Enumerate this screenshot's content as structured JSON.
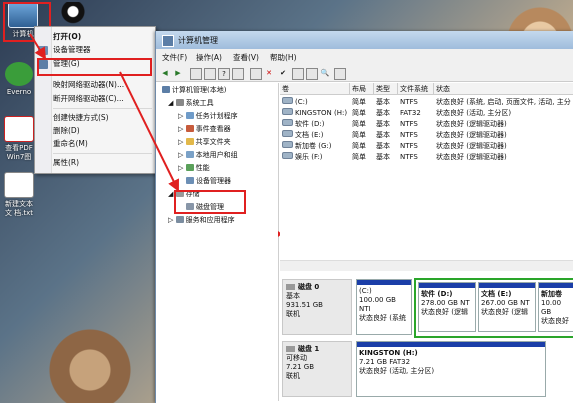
{
  "desktop": {
    "computer_icon_label": "计算机",
    "icons": [
      {
        "label": "Everno",
        "top": 0
      },
      {
        "label": "查看PDF Win7图",
        "top": 0
      },
      {
        "label": "新建文本文 档.txt",
        "top": 0
      }
    ]
  },
  "context_menu": {
    "items": [
      {
        "label": "打开(O)",
        "bold": true
      },
      {
        "label": "设备管理器",
        "bold": false
      },
      {
        "label": "管理(G)",
        "bold": false
      },
      {
        "label": "映射网络驱动器(N)...",
        "bold": false
      },
      {
        "label": "断开网络驱动器(C)...",
        "bold": false
      },
      {
        "label": "创建快捷方式(S)",
        "bold": false
      },
      {
        "label": "删除(D)",
        "bold": false
      },
      {
        "label": "重命名(M)",
        "bold": false
      },
      {
        "label": "属性(R)",
        "bold": false
      }
    ]
  },
  "window": {
    "title": "计算机管理",
    "menu": [
      "文件(F)",
      "操作(A)",
      "查看(V)",
      "帮助(H)"
    ]
  },
  "tree": {
    "root": "计算机管理(本地)",
    "system_tools": "系统工具",
    "task_scheduler": "任务计划程序",
    "event_viewer": "事件查看器",
    "shared_folders": "共享文件夹",
    "local_users": "本地用户和组",
    "performance": "性能",
    "device_manager": "设备管理器",
    "storage": "存储",
    "disk_management": "磁盘管理",
    "services": "服务和应用程序"
  },
  "volumes": {
    "headers": [
      "卷",
      "布局",
      "类型",
      "文件系统",
      "状态"
    ],
    "rows": [
      [
        "(C:)",
        "简单",
        "基本",
        "NTFS",
        "状态良好 (系统, 启动, 页面文件, 活动, 主分"
      ],
      [
        "KINGSTON (H:)",
        "简单",
        "基本",
        "FAT32",
        "状态良好 (活动, 主分区)"
      ],
      [
        "软件 (D:)",
        "简单",
        "基本",
        "NTFS",
        "状态良好 (逻辑驱动器)"
      ],
      [
        "文档 (E:)",
        "简单",
        "基本",
        "NTFS",
        "状态良好 (逻辑驱动器)"
      ],
      [
        "新加卷 (G:)",
        "简单",
        "基本",
        "NTFS",
        "状态良好 (逻辑驱动器)"
      ],
      [
        "娱乐 (F:)",
        "简单",
        "基本",
        "NTFS",
        "状态良好 (逻辑驱动器)"
      ]
    ]
  },
  "disk0": {
    "name": "磁盘 0",
    "type": "基本",
    "size": "931.51 GB",
    "status": "联机",
    "partitions": [
      {
        "name": "(C:)",
        "size": "100.00 GB NTI",
        "status": "状态良好 (系统"
      },
      {
        "name": "软件 (D:)",
        "size": "278.00 GB NT",
        "status": "状态良好 (逻辑"
      },
      {
        "name": "文档 (E:)",
        "size": "267.00 GB NT",
        "status": "状态良好 (逻辑"
      },
      {
        "name": "新加卷",
        "size": "10.00 GB",
        "status": "状态良好"
      }
    ]
  },
  "disk1": {
    "name": "磁盘 1",
    "type": "可移动",
    "size": "7.21 GB",
    "status": "联机",
    "partition": {
      "name": "KINGSTON  (H:)",
      "size": "7.21 GB FAT32",
      "status": "状态良好 (活动, 主分区)"
    }
  },
  "colors": {
    "highlight": "#e02020",
    "partition_bar": "#1b3ea8",
    "extended_frame": "#2aa52a"
  }
}
